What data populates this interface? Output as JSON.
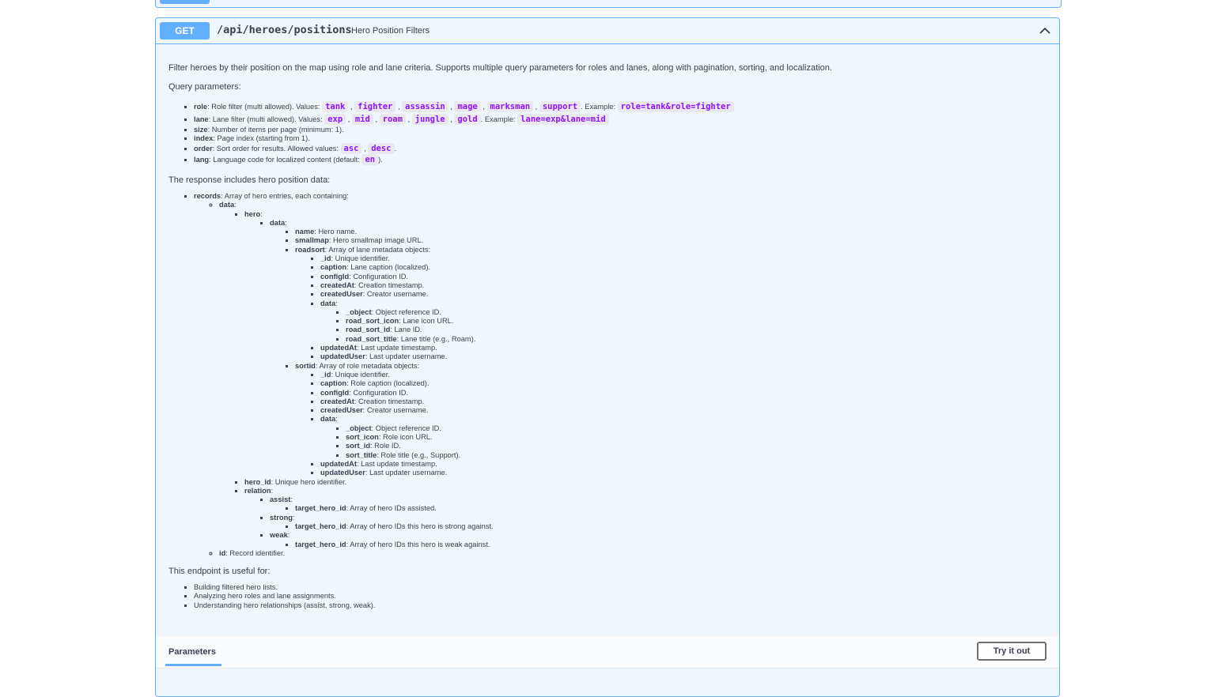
{
  "endpoint": {
    "method": "GET",
    "path": "/api/heroes/positions",
    "summary": "Hero Position Filters"
  },
  "description": {
    "intro": "Filter heroes by their position on the map using role and lane criteria. Supports multiple query parameters for roles and lanes, along with pagination, sorting, and localization.",
    "query_heading": "Query parameters:",
    "role": {
      "name": "role",
      "text": ": Role filter (multi allowed). Values: ",
      "values": [
        "tank",
        "fighter",
        "assassin",
        "mage",
        "marksman",
        "support"
      ],
      "example_label": ". Example: ",
      "example": "role=tank&role=fighter"
    },
    "lane": {
      "name": "lane",
      "text": ": Lane filter (multi allowed). Values: ",
      "values": [
        "exp",
        "mid",
        "roam",
        "jungle",
        "gold"
      ],
      "example_label": ". Example: ",
      "example": "lane=exp&lane=mid"
    },
    "size": {
      "name": "size",
      "text": ": Number of items per page (minimum: 1)."
    },
    "index": {
      "name": "index",
      "text": ": Page index (starting from 1)."
    },
    "order": {
      "name": "order",
      "text": ": Sort order for results. Allowed values: ",
      "values": [
        "asc",
        "desc"
      ],
      "end": "."
    },
    "lang": {
      "name": "lang",
      "text": ": Language code for localized content (default: ",
      "default": "en",
      "end": ")."
    },
    "response_heading": "The response includes hero position data:",
    "tree": {
      "records": {
        "name": "records",
        "text": ": Array of hero entries, each containing:"
      },
      "data": {
        "name": "data",
        "text": ":"
      },
      "hero": {
        "name": "hero",
        "text": ":"
      },
      "hero_data": {
        "name": "data",
        "text": ":"
      },
      "name": {
        "name": "name",
        "text": ": Hero name."
      },
      "smallmap": {
        "name": "smallmap",
        "text": ": Hero smallmap image URL."
      },
      "roadsort": {
        "name": "roadsort",
        "text": ": Array of lane metadata objects:"
      },
      "roadsort_fields": [
        {
          "name": "_id",
          "text": ": Unique identifier."
        },
        {
          "name": "caption",
          "text": ": Lane caption (localized)."
        },
        {
          "name": "configId",
          "text": ": Configuration ID."
        },
        {
          "name": "createdAt",
          "text": ": Creation timestamp."
        },
        {
          "name": "createdUser",
          "text": ": Creator username."
        }
      ],
      "roadsort_data": {
        "name": "data",
        "text": ":"
      },
      "roadsort_data_fields": [
        {
          "name": "_object",
          "text": ": Object reference ID."
        },
        {
          "name": "road_sort_icon",
          "text": ": Lane icon URL."
        },
        {
          "name": "road_sort_id",
          "text": ": Lane ID."
        },
        {
          "name": "road_sort_title",
          "text": ": Lane title (e.g., Roam)."
        }
      ],
      "roadsort_tail": [
        {
          "name": "updatedAt",
          "text": ": Last update timestamp."
        },
        {
          "name": "updatedUser",
          "text": ": Last updater username."
        }
      ],
      "sortid": {
        "name": "sortid",
        "text": ": Array of role metadata objects:"
      },
      "sortid_fields": [
        {
          "name": "_id",
          "text": ": Unique identifier."
        },
        {
          "name": "caption",
          "text": ": Role caption (localized)."
        },
        {
          "name": "configId",
          "text": ": Configuration ID."
        },
        {
          "name": "createdAt",
          "text": ": Creation timestamp."
        },
        {
          "name": "createdUser",
          "text": ": Creator username."
        }
      ],
      "sortid_data": {
        "name": "data",
        "text": ":"
      },
      "sortid_data_fields": [
        {
          "name": "_object",
          "text": ": Object reference ID."
        },
        {
          "name": "sort_icon",
          "text": ": Role icon URL."
        },
        {
          "name": "sort_id",
          "text": ": Role ID."
        },
        {
          "name": "sort_title",
          "text": ": Role title (e.g., Support)."
        }
      ],
      "sortid_tail": [
        {
          "name": "updatedAt",
          "text": ": Last update timestamp."
        },
        {
          "name": "updatedUser",
          "text": ": Last updater username."
        }
      ],
      "hero_id": {
        "name": "hero_id",
        "text": ": Unique hero identifier."
      },
      "relation": {
        "name": "relation",
        "text": ":"
      },
      "assist": {
        "name": "assist",
        "text": ":"
      },
      "assist_target": {
        "name": "target_hero_id",
        "text": ": Array of hero IDs assisted."
      },
      "strong": {
        "name": "strong",
        "text": ":"
      },
      "strong_target": {
        "name": "target_hero_id",
        "text": ": Array of hero IDs this hero is strong against."
      },
      "weak": {
        "name": "weak",
        "text": ":"
      },
      "weak_target": {
        "name": "target_hero_id",
        "text": ": Array of hero IDs this hero is weak against."
      },
      "id": {
        "name": "id",
        "text": ": Record identifier."
      }
    },
    "uses_heading": "This endpoint is useful for:",
    "uses": [
      "Building filtered hero lists.",
      "Analyzing hero roles and lane assignments.",
      "Understanding hero relationships (assist, strong, weak)."
    ]
  },
  "parameters_bar": {
    "tab_label": "Parameters",
    "try_button": "Try it out"
  },
  "colors": {
    "get_accent": "#61affe",
    "block_bg": "#eff6fc",
    "code_color": "#9012fe"
  }
}
